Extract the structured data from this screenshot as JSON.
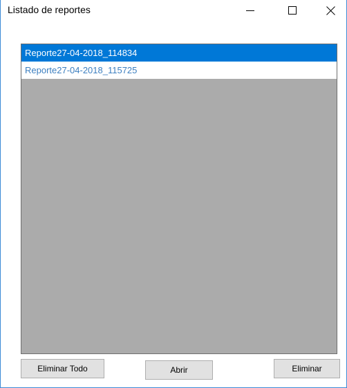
{
  "window": {
    "title": "Listado de reportes",
    "controls": {
      "minimize_icon": "minimize-icon",
      "maximize_icon": "maximize-icon",
      "close_icon": "close-icon"
    }
  },
  "reports": {
    "items": [
      {
        "label": "Reporte27-04-2018_114834",
        "selected": true
      },
      {
        "label": "Reporte27-04-2018_115725",
        "selected": false
      }
    ]
  },
  "buttons": {
    "delete_all": "Eliminar Todo",
    "open": "Abrir",
    "delete": "Eliminar"
  },
  "colors": {
    "selection": "#0078d7",
    "list_background": "#ababab",
    "unselected_text": "#3c7fc0",
    "window_border": "#3a8ad6"
  }
}
